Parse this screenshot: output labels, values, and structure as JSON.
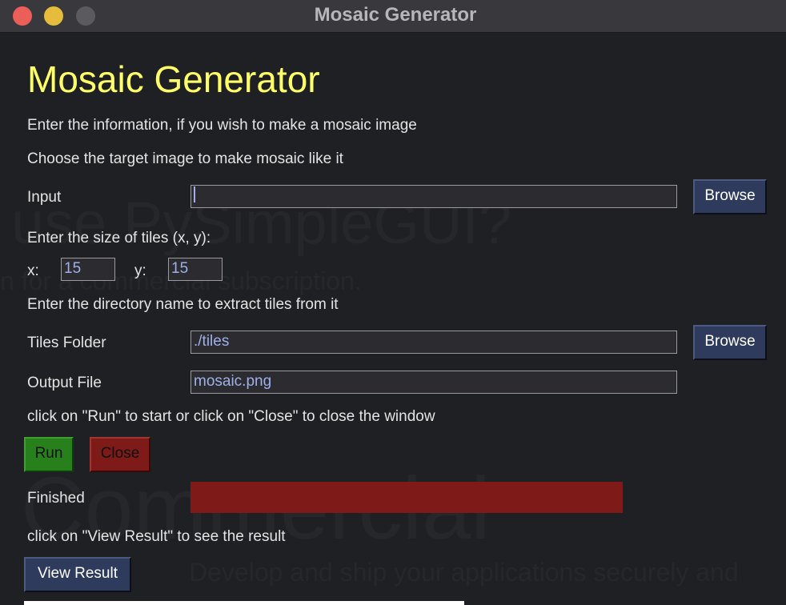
{
  "window": {
    "title": "Mosaic Generator"
  },
  "background_ghost": {
    "line1": "use PySimpleGUI?",
    "line2": "n for a commercial subscription.",
    "line3": "Commercial",
    "line4": "Develop and ship your applications securely and"
  },
  "main": {
    "heading": "Mosaic Generator",
    "intro": "Enter the information, if you wish to make a mosaic image",
    "choose_target": "Choose the target image to make mosaic like it",
    "input_label": "Input",
    "input_value": "",
    "browse_label": "Browse",
    "tile_size_label": "Enter the size of tiles (x, y):",
    "x_label": "x:",
    "x_value": "15",
    "y_label": "y:",
    "y_value": "15",
    "dir_instruction": "Enter the directory name to extract tiles from it",
    "tiles_folder_label": "Tiles Folder",
    "tiles_folder_value": "./tiles",
    "output_file_label": "Output File",
    "output_file_value": "mosaic.png",
    "run_instruction": "click on \"Run\" to start or click on \"Close\" to close the window",
    "run_label": "Run",
    "close_label": "Close",
    "finished_label": "Finished",
    "progress_fraction": 1.0,
    "view_instruction": "click on \"View Result\" to see the result",
    "view_result_label": "View Result"
  },
  "colors": {
    "heading": "#ffff68",
    "run_button": "#28801d",
    "close_button": "#7e1a17",
    "browse_button": "#2f3b5c",
    "progress_fill": "#7e1a17"
  }
}
